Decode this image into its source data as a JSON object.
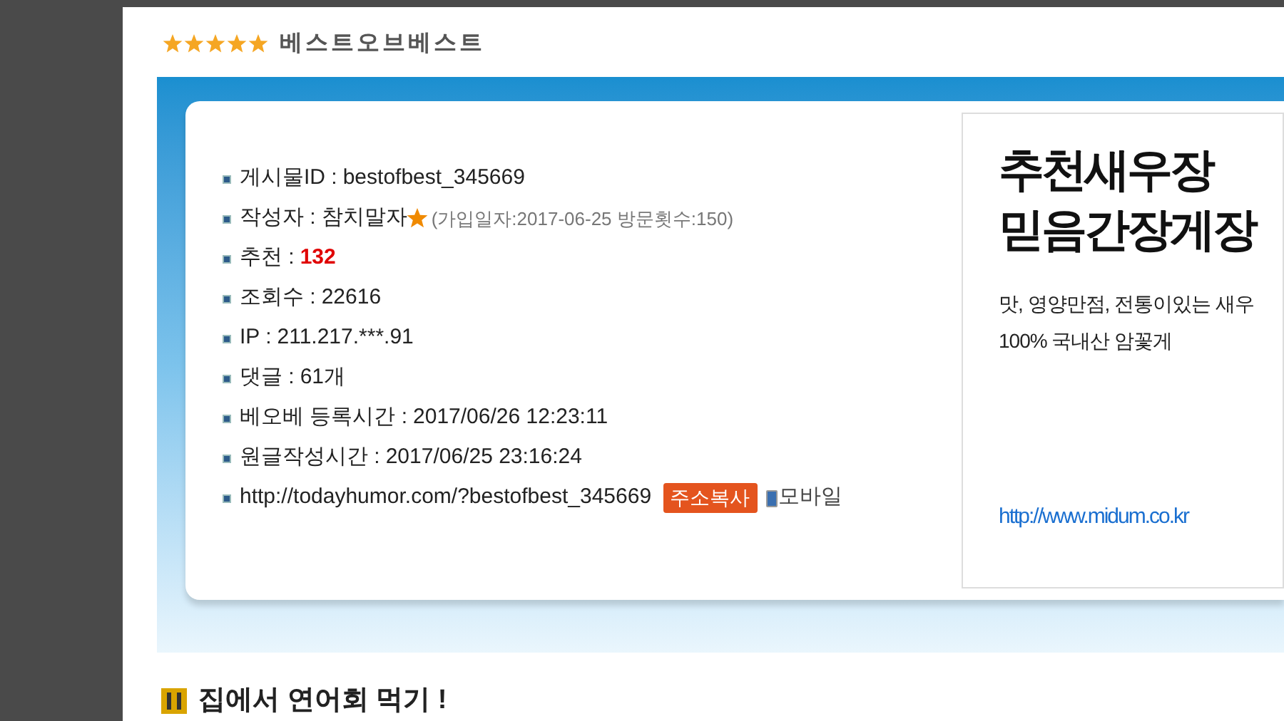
{
  "header": {
    "title": "베스트오브베스트"
  },
  "info_rows": [
    {
      "kind": "plain",
      "label": "게시물ID :",
      "value": "bestofbest_345669"
    },
    {
      "kind": "author",
      "label": "작성자 :",
      "value": "참치말자",
      "note": "(가입일자:2017-06-25 방문횟수:150)"
    },
    {
      "kind": "highlight",
      "label": "추천 :",
      "value": "132"
    },
    {
      "kind": "plain",
      "label": "조회수 :",
      "value": "22616"
    },
    {
      "kind": "plain",
      "label": "IP :",
      "value": "211.217.***.91"
    },
    {
      "kind": "plain",
      "label": "댓글 :",
      "value": "61개"
    },
    {
      "kind": "plain",
      "label": "베오베 등록시간 :",
      "value": "2017/06/26 12:23:11"
    },
    {
      "kind": "plain",
      "label": "원글작성시간 :",
      "value": "2017/06/25 23:16:24"
    },
    {
      "kind": "link",
      "value": "http://todayhumor.com/?bestofbest_345669",
      "button": "주소복사",
      "mobile": "모바일"
    }
  ],
  "ad": {
    "headline": [
      "추천새우장",
      "믿음간장게장"
    ],
    "lines": [
      "맛, 영양만점, 전통이있는 새우",
      "100% 국내산 암꽃게"
    ],
    "url": "http://www.midum.co.kr"
  },
  "post_title": "집에서 연어회 먹기 !"
}
